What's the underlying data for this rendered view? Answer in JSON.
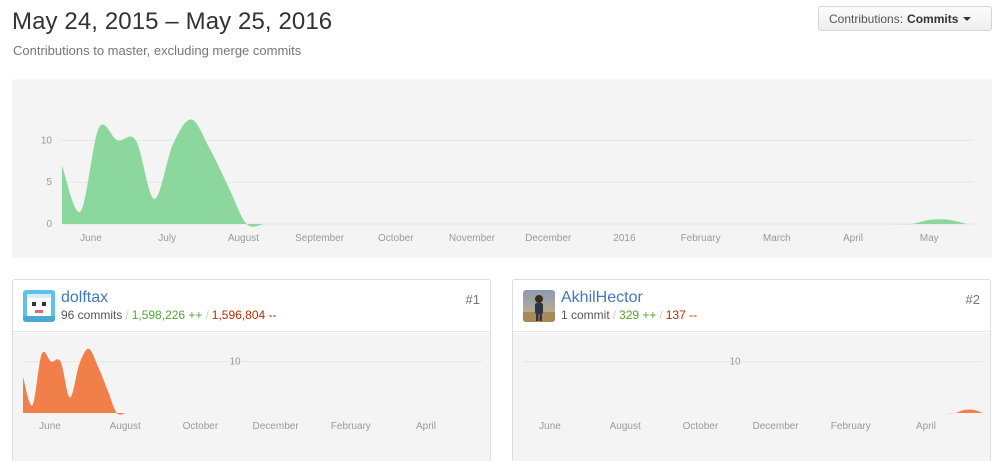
{
  "header": {
    "title": "May 24, 2015 – May 25, 2016",
    "subtitle": "Contributions to master, excluding merge commits"
  },
  "contrib_select": {
    "label": "Contributions:",
    "value": "Commits"
  },
  "colors": {
    "main_area": "#8cd79e",
    "contributor_area": "#f17f49",
    "link": "#4078c0",
    "additions": "#55a532",
    "deletions": "#bd2c00"
  },
  "chart_data": [
    {
      "type": "area",
      "title": "",
      "series": [
        {
          "values": [
            7,
            1.5,
            11.5,
            10,
            10,
            3,
            9.5,
            12.5,
            9,
            4.5,
            0,
            0,
            0,
            0,
            0,
            0,
            0,
            0,
            0,
            0,
            0,
            0,
            0,
            0,
            0,
            0,
            0,
            0,
            0,
            0,
            0,
            0,
            0,
            0,
            0,
            0,
            0,
            0,
            0,
            0,
            0,
            0,
            0,
            0,
            0,
            0,
            0,
            0.5,
            0.5,
            0
          ]
        }
      ],
      "x_ticks": [
        "June",
        "July",
        "August",
        "September",
        "October",
        "November",
        "December",
        "2016",
        "February",
        "March",
        "April",
        "May"
      ],
      "y_ticks": [
        "0",
        "5",
        "10"
      ],
      "ylim": [
        0,
        14
      ],
      "grid": true
    },
    {
      "type": "area",
      "title": "",
      "series": [
        {
          "values": [
            7,
            1.5,
            11.5,
            10,
            10,
            3,
            9.5,
            12.5,
            9,
            4.5,
            0,
            0,
            0,
            0,
            0,
            0,
            0,
            0,
            0,
            0,
            0,
            0,
            0,
            0,
            0,
            0,
            0,
            0,
            0,
            0,
            0,
            0,
            0,
            0,
            0,
            0,
            0,
            0,
            0,
            0,
            0,
            0,
            0,
            0,
            0,
            0,
            0,
            0,
            0,
            0
          ]
        }
      ],
      "x_ticks": [
        "June",
        "August",
        "October",
        "December",
        "February",
        "April"
      ],
      "y_ticks": [
        "10"
      ],
      "ylim": [
        0,
        14
      ],
      "grid": true
    },
    {
      "type": "area",
      "title": "",
      "series": [
        {
          "values": [
            0,
            0,
            0,
            0,
            0,
            0,
            0,
            0,
            0,
            0,
            0,
            0,
            0,
            0,
            0,
            0,
            0,
            0,
            0,
            0,
            0,
            0,
            0,
            0,
            0,
            0,
            0,
            0,
            0,
            0,
            0,
            0,
            0,
            0,
            0,
            0,
            0,
            0,
            0,
            0,
            0,
            0,
            0,
            0,
            0,
            0,
            0,
            0.6,
            0.6,
            0
          ]
        }
      ],
      "x_ticks": [
        "June",
        "August",
        "October",
        "December",
        "February",
        "April"
      ],
      "y_ticks": [
        "10"
      ],
      "ylim": [
        0,
        14
      ],
      "grid": true
    }
  ],
  "contributors": [
    {
      "username": "dolftax",
      "commits": "96 commits",
      "additions": "1,598,226 ++",
      "deletions": "1,596,804 --",
      "rank": "#1"
    },
    {
      "username": "AkhilHector",
      "commits": "1 commit",
      "additions": "329 ++",
      "deletions": "137 --",
      "rank": "#2"
    }
  ]
}
